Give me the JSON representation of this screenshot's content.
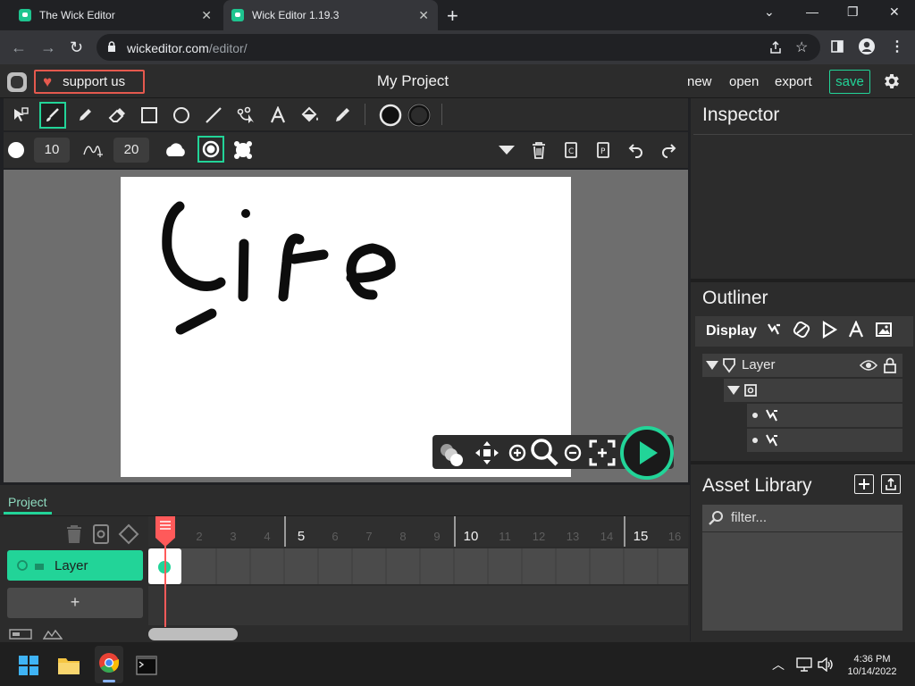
{
  "browser": {
    "tabs": [
      {
        "title": "The Wick Editor"
      },
      {
        "title": "Wick Editor 1.19.3"
      }
    ],
    "url_host": "wickeditor.com",
    "url_path": "/editor/"
  },
  "app": {
    "support_label": "support us",
    "project_title": "My Project",
    "menu": {
      "new": "new",
      "open": "open",
      "export": "export",
      "save": "save"
    },
    "brush_size": "10",
    "brush_smoothing": "20",
    "canvas_drawing_text": "Life"
  },
  "inspector": {
    "title": "Inspector"
  },
  "outliner": {
    "title": "Outliner",
    "display_label": "Display",
    "layer_name": "Layer"
  },
  "assets": {
    "title": "Asset Library",
    "filter_placeholder": "filter..."
  },
  "timeline": {
    "tab_label": "Project",
    "layer_name": "Layer",
    "add_layer": "+",
    "frame_numbers": [
      "2",
      "3",
      "4",
      "5",
      "6",
      "7",
      "8",
      "9",
      "10",
      "11",
      "12",
      "13",
      "14",
      "15",
      "16"
    ],
    "highlight_frames": [
      "5",
      "10",
      "15"
    ]
  },
  "taskbar": {
    "time": "4:36 PM",
    "date": "10/14/2022"
  },
  "colors": {
    "accent": "#22d498",
    "support_red": "#e5594e"
  }
}
